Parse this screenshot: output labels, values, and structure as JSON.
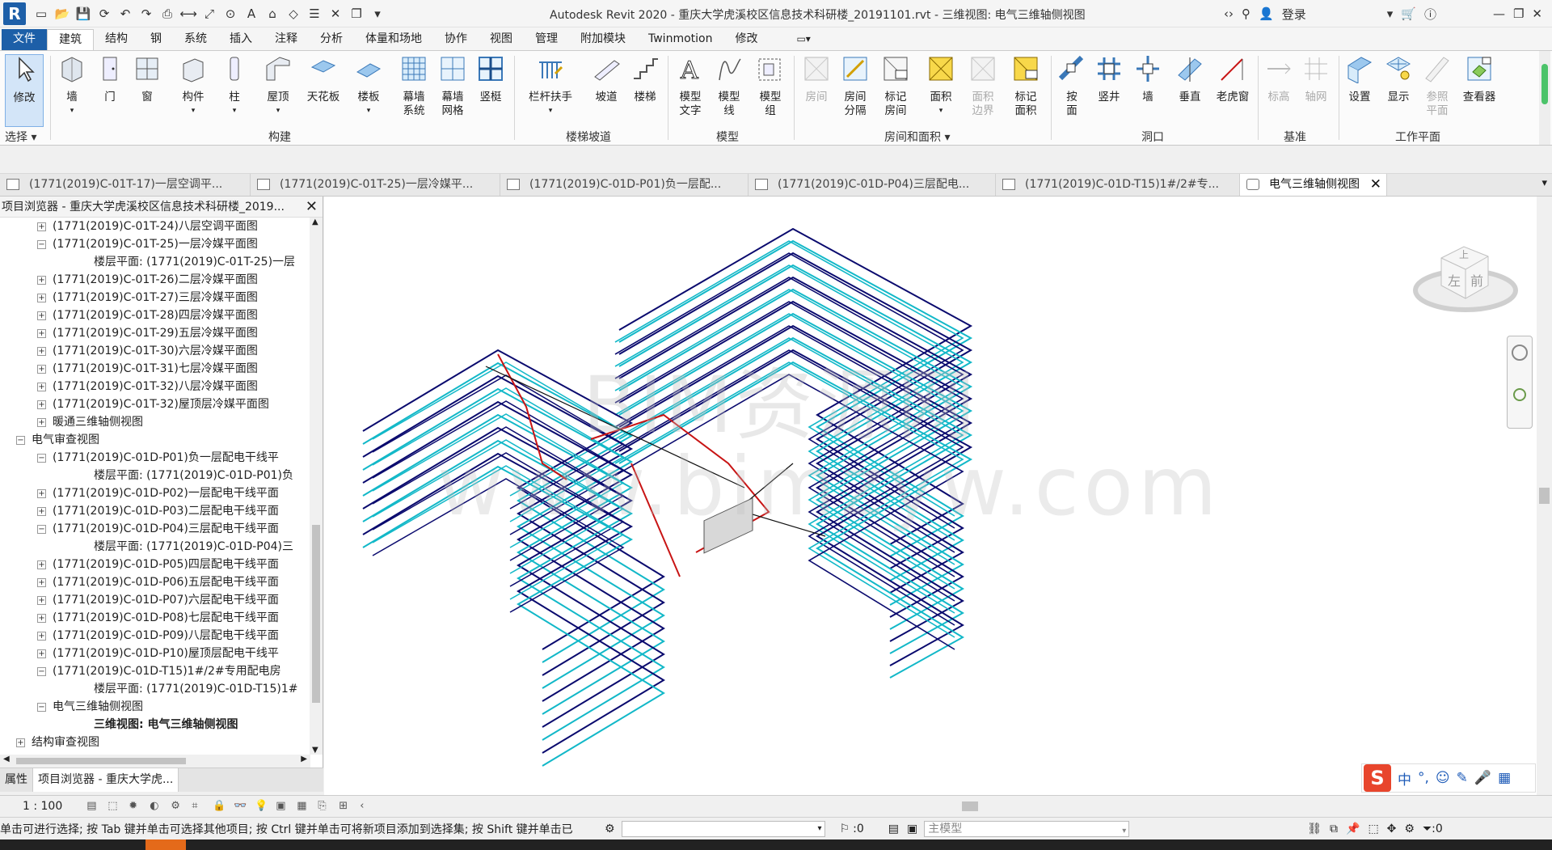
{
  "app": {
    "logo": "R",
    "title": "Autodesk Revit 2020 - 重庆大学虎溪校区信息技术科研楼_20191101.rvt - 三维视图: 电气三维轴侧视图",
    "login": "登录"
  },
  "ribbon_tabs": [
    "文件",
    "建筑",
    "结构",
    "钢",
    "系统",
    "插入",
    "注释",
    "分析",
    "体量和场地",
    "协作",
    "视图",
    "管理",
    "附加模块",
    "Twinmotion",
    "修改"
  ],
  "tools": {
    "modify": "修改",
    "wall": "墙",
    "door": "门",
    "window": "窗",
    "component": "构件",
    "column": "柱",
    "roof": "屋顶",
    "ceiling": "天花板",
    "floor": "楼板",
    "curtain_system_1": "幕墙",
    "curtain_system_2": "系统",
    "curtain_grid_1": "幕墙",
    "curtain_grid_2": "网格",
    "mullion": "竖梃",
    "railing": "栏杆扶手",
    "ramp": "坡道",
    "stair": "楼梯",
    "model_text_1": "模型",
    "model_text_2": "文字",
    "model_line_1": "模型",
    "model_line_2": "线",
    "model_group_1": "模型",
    "model_group_2": "组",
    "room": "房间",
    "room_sep_1": "房间",
    "room_sep_2": "分隔",
    "tag_room_1": "标记",
    "tag_room_2": "房间",
    "area": "面积",
    "area_boundary_1": "面积",
    "area_boundary_2": "边界",
    "tag_area_1": "标记",
    "tag_area_2": "面积",
    "by_face_1": "按",
    "by_face_2": "面",
    "shaft": "竖井",
    "op_wall": "墙",
    "vertical": "垂直",
    "dormer": "老虎窗",
    "level": "标高",
    "grid": "轴网",
    "set": "设置",
    "show": "显示",
    "ref_plane_1": "参照",
    "ref_plane_2": "平面",
    "viewer": "查看器"
  },
  "panels": {
    "select": "选择",
    "build": "构建",
    "circulation": "楼梯坡道",
    "model": "模型",
    "room_area": "房间和面积",
    "opening": "洞口",
    "datum": "基准",
    "work_plane": "工作平面"
  },
  "doc_tabs": [
    "(1771(2019)C-01T-17)一层空调平...",
    "(1771(2019)C-01T-25)一层冷媒平...",
    "(1771(2019)C-01D-P01)负一层配...",
    "(1771(2019)C-01D-P04)三层配电...",
    "(1771(2019)C-01D-T15)1#/2#专...",
    "电气三维轴侧视图"
  ],
  "browser": {
    "title": "项目浏览器 - 重庆大学虎溪校区信息技术科研楼_2019...",
    "nodes": [
      {
        "t": "+",
        "text": "(1771(2019)C-01T-24)八层空调平面图"
      },
      {
        "t": "-",
        "text": "(1771(2019)C-01T-25)一层冷媒平面图"
      },
      {
        "t": "",
        "text": "楼层平面: (1771(2019)C-01T-25)一层"
      },
      {
        "t": "+",
        "text": "(1771(2019)C-01T-26)二层冷媒平面图"
      },
      {
        "t": "+",
        "text": "(1771(2019)C-01T-27)三层冷媒平面图"
      },
      {
        "t": "+",
        "text": "(1771(2019)C-01T-28)四层冷媒平面图"
      },
      {
        "t": "+",
        "text": "(1771(2019)C-01T-29)五层冷媒平面图"
      },
      {
        "t": "+",
        "text": "(1771(2019)C-01T-30)六层冷媒平面图"
      },
      {
        "t": "+",
        "text": "(1771(2019)C-01T-31)七层冷媒平面图"
      },
      {
        "t": "+",
        "text": "(1771(2019)C-01T-32)八层冷媒平面图"
      },
      {
        "t": "+",
        "text": "(1771(2019)C-01T-32)屋顶层冷媒平面图"
      },
      {
        "t": "+",
        "text": "暖通三维轴侧视图"
      },
      {
        "t": "-",
        "text": "电气审查视图"
      },
      {
        "t": "-",
        "text": "(1771(2019)C-01D-P01)负一层配电干线平"
      },
      {
        "t": "",
        "text": "楼层平面: (1771(2019)C-01D-P01)负"
      },
      {
        "t": "+",
        "text": "(1771(2019)C-01D-P02)一层配电干线平面"
      },
      {
        "t": "+",
        "text": "(1771(2019)C-01D-P03)二层配电干线平面"
      },
      {
        "t": "-",
        "text": "(1771(2019)C-01D-P04)三层配电干线平面"
      },
      {
        "t": "",
        "text": "楼层平面: (1771(2019)C-01D-P04)三"
      },
      {
        "t": "+",
        "text": "(1771(2019)C-01D-P05)四层配电干线平面"
      },
      {
        "t": "+",
        "text": "(1771(2019)C-01D-P06)五层配电干线平面"
      },
      {
        "t": "+",
        "text": "(1771(2019)C-01D-P07)六层配电干线平面"
      },
      {
        "t": "+",
        "text": "(1771(2019)C-01D-P08)七层配电干线平面"
      },
      {
        "t": "+",
        "text": "(1771(2019)C-01D-P09)八层配电干线平面"
      },
      {
        "t": "+",
        "text": "(1771(2019)C-01D-P10)屋顶层配电干线平"
      },
      {
        "t": "-",
        "text": "(1771(2019)C-01D-T15)1#/2#专用配电房"
      },
      {
        "t": "",
        "text": "楼层平面: (1771(2019)C-01D-T15)1#"
      },
      {
        "t": "-",
        "text": "电气三维轴侧视图"
      },
      {
        "t": "",
        "text": "三维视图: 电气三维轴侧视图"
      },
      {
        "t": "+",
        "text": "结构审查视图"
      }
    ],
    "tabs": [
      "属性",
      "项目浏览器 - 重庆大学虎..."
    ]
  },
  "viewcube": {
    "top": "上",
    "left": "左",
    "front": "前"
  },
  "watermark": {
    "line1": "BIM资源网",
    "line2": "www.bimzyw.com"
  },
  "viewbar": {
    "scale": "1 : 100"
  },
  "statusbar": {
    "hint": "单击可进行选择; 按 Tab 键并单击可选择其他项目; 按 Ctrl 键并单击可将新项目添加到选择集; 按 Shift 键并单击已",
    "count1": ":0",
    "model": "主模型",
    "count2": ":0"
  },
  "ime": {
    "zh": "中"
  },
  "colors": {
    "file_tab": "#1d5fa8",
    "pipe_navy": "#0a0a6e",
    "pipe_cyan": "#12b8c8",
    "pipe_red": "#c81414",
    "pipe_black": "#111111"
  }
}
